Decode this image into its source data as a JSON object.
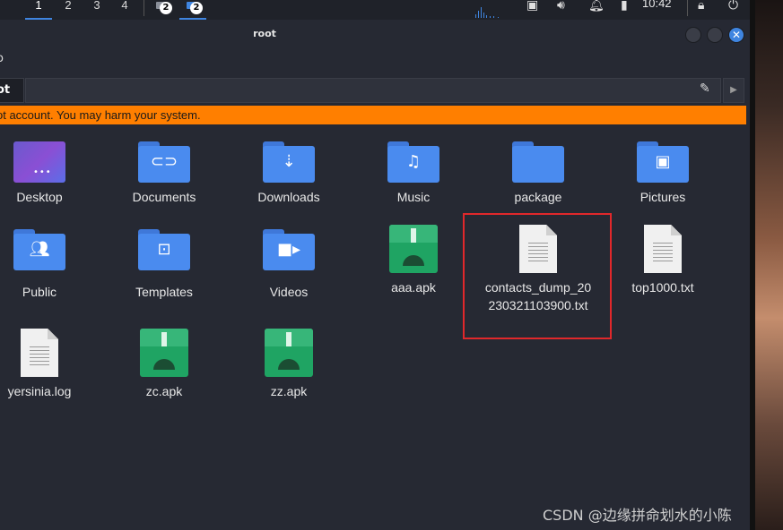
{
  "panel": {
    "workspaces": [
      "1",
      "2",
      "3",
      "4"
    ],
    "active_workspace": "1",
    "task_badges": [
      "2",
      "2"
    ],
    "clock": "10:42"
  },
  "window": {
    "title": "root",
    "menu_fragment": "o",
    "path_fragment": "ot",
    "warning": "ot account. You may harm your system."
  },
  "files": [
    {
      "name": "Desktop",
      "kind": "desktop"
    },
    {
      "name": "Documents",
      "kind": "folder",
      "icon": "attachment-icon"
    },
    {
      "name": "Downloads",
      "kind": "folder",
      "icon": "download-icon"
    },
    {
      "name": "Music",
      "kind": "folder",
      "icon": "music-note-icon"
    },
    {
      "name": "package",
      "kind": "folder",
      "icon": "folder-icon"
    },
    {
      "name": "Pictures",
      "kind": "folder",
      "icon": "picture-icon"
    },
    {
      "name": "Public",
      "kind": "folder",
      "icon": "people-icon"
    },
    {
      "name": "Templates",
      "kind": "folder",
      "icon": "template-icon"
    },
    {
      "name": "Videos",
      "kind": "folder",
      "icon": "video-icon"
    },
    {
      "name": "aaa.apk",
      "kind": "apk"
    },
    {
      "name": "contacts_dump_20\n230321103900.txt",
      "kind": "text",
      "highlighted": true
    },
    {
      "name": "top1000.txt",
      "kind": "text"
    },
    {
      "name": "yersinia.log",
      "kind": "text"
    },
    {
      "name": "zc.apk",
      "kind": "apk"
    },
    {
      "name": "zz.apk",
      "kind": "apk"
    }
  ],
  "watermark": "CSDN @边缘拼命划水的小陈",
  "colors": {
    "accent": "#3f85e0",
    "warning": "#ff7f00",
    "highlight": "#e0282b",
    "apk": "#1fa463"
  }
}
